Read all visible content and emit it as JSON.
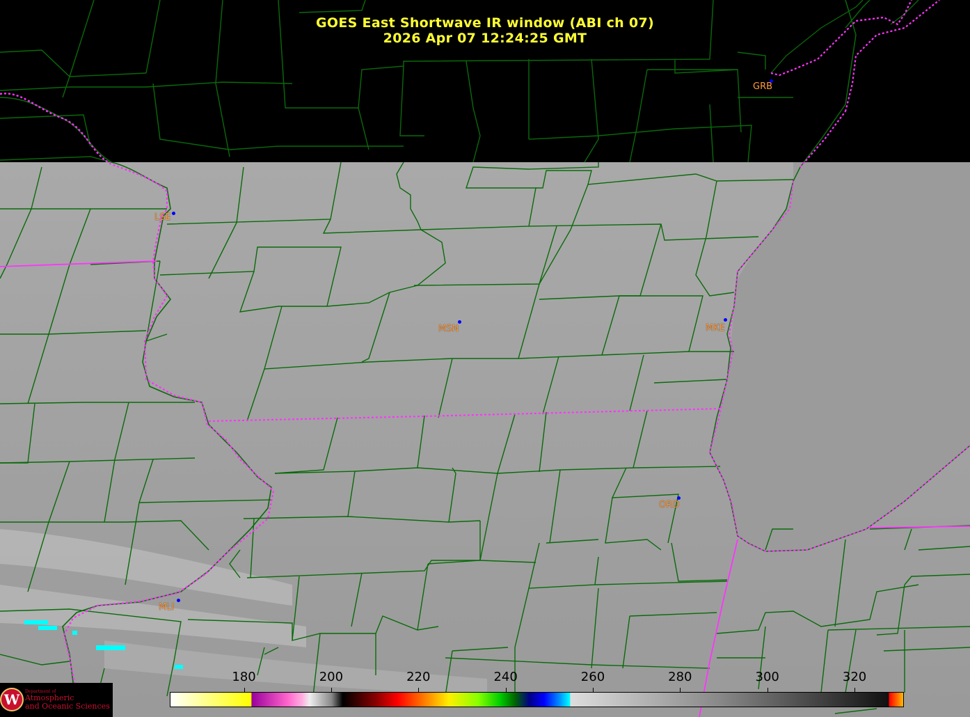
{
  "header": {
    "title_line1": "GOES East Shortwave IR window (ABI ch 07)",
    "title_line2": "2026 Apr 07  12:24:25 GMT"
  },
  "stations": [
    {
      "id": "grb",
      "label": "GRB"
    },
    {
      "id": "lse",
      "label": "LSE"
    },
    {
      "id": "msn",
      "label": "MSN"
    },
    {
      "id": "mke",
      "label": "MKE"
    },
    {
      "id": "ord",
      "label": "ORD"
    },
    {
      "id": "mli",
      "label": "MLI"
    }
  ],
  "colorbar": {
    "units": "",
    "ticks": [
      "180",
      "200",
      "220",
      "240",
      "260",
      "280",
      "300",
      "320"
    ],
    "tick_values": [
      180,
      200,
      220,
      240,
      260,
      280,
      300,
      320
    ],
    "range": [
      163,
      331
    ]
  },
  "logo": {
    "line1": "Department of",
    "line2": "Atmospheric",
    "line3": "and Oceanic Sciences",
    "emblem": "W"
  },
  "colors": {
    "title": "#ffff33",
    "county_lines": "#0a6a0a",
    "state_lines": "#ff33ff",
    "station_labels": "#ff9a3c",
    "station_dots": "#0000ff",
    "background_no_data": "#000000",
    "cloud_free_gray": "#a8a8a8",
    "lake_gray": "#9a9a9a"
  }
}
